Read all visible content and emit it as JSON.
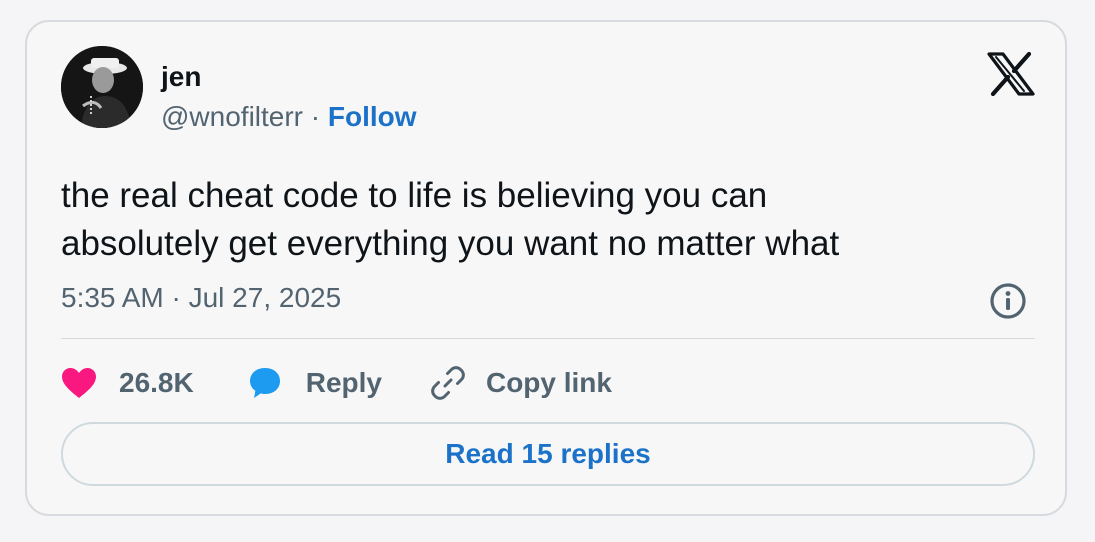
{
  "author": {
    "name": "jen",
    "handle": "@wnofilterr",
    "separator": " · ",
    "follow_label": "Follow",
    "avatar_icon": "profile-photo"
  },
  "brand": {
    "logo_icon": "x-logo-icon"
  },
  "tweet": {
    "text_line1": "the real cheat code to life is believing you can",
    "text_line2": "absolutely get everything you want no matter what",
    "timestamp": "5:35 AM · Jul 27, 2025"
  },
  "actions": {
    "like_count": "26.8K",
    "reply_label": "Reply",
    "copy_link_label": "Copy link"
  },
  "read_replies_label": "Read 15 replies",
  "colors": {
    "accent": "#1b72c8",
    "like": "#f91880",
    "reply_bubble": "#1d9bf0",
    "muted_text": "#536471"
  }
}
